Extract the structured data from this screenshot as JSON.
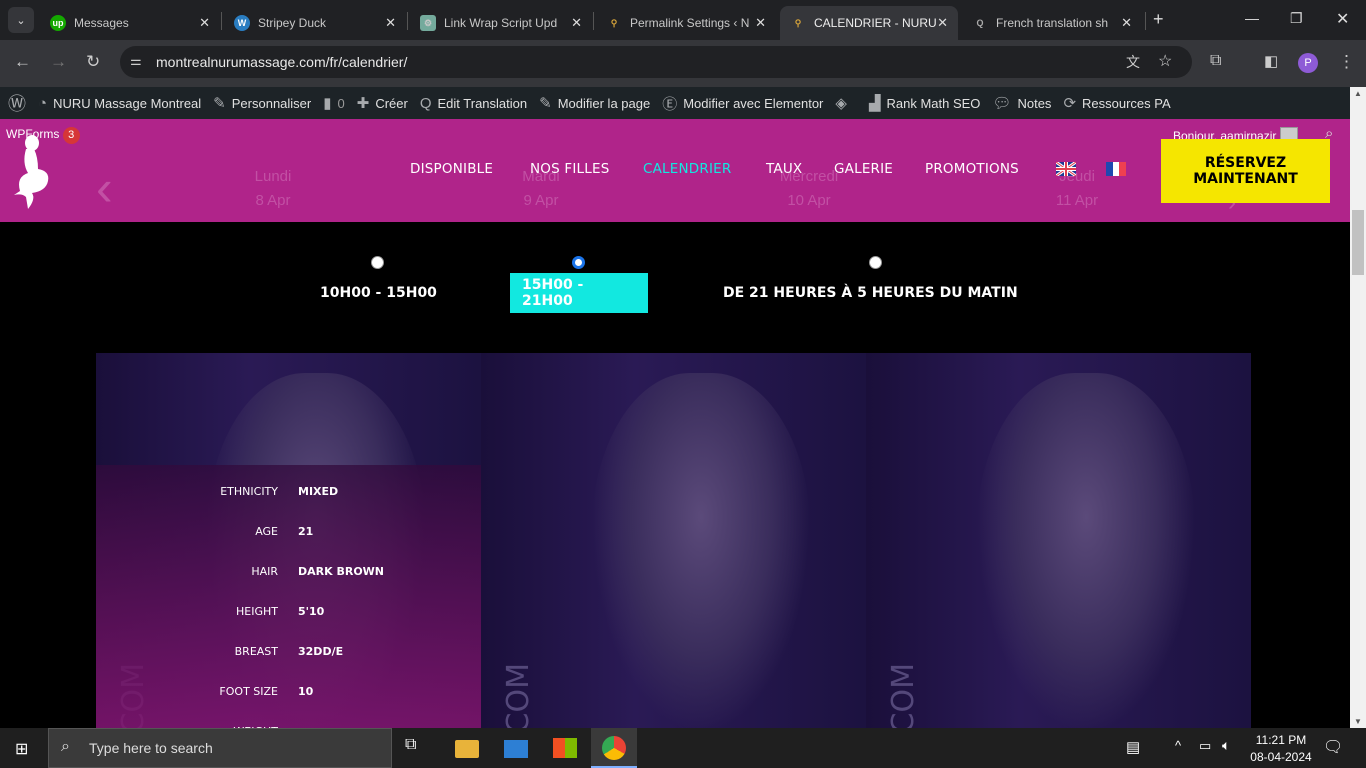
{
  "browser": {
    "tabs": [
      {
        "title": "Messages",
        "icon": "upwork-icon"
      },
      {
        "title": "Stripey Duck",
        "icon": "wordpress-icon"
      },
      {
        "title": "Link Wrap Script Upd",
        "icon": "chatgpt-icon"
      },
      {
        "title": "Permalink Settings ‹ N",
        "icon": "mermaid-icon"
      },
      {
        "title": "CALENDRIER - NURU",
        "icon": "mermaid-icon",
        "active": true
      },
      {
        "title": "French translation sh",
        "icon": "loco-icon"
      }
    ],
    "url": "montrealnurumassage.com/fr/calendrier/",
    "profile_initial": "P"
  },
  "wp_admin_bar": {
    "site": "NURU Massage Montreal",
    "customize": "Personnaliser",
    "comments": "0",
    "new": "Créer",
    "edit_translation": "Edit Translation",
    "edit_page": "Modifier la page",
    "elementor": "Modifier avec Elementor",
    "rank_math": "Rank Math SEO",
    "notes": "Notes",
    "resources": "Ressources PA",
    "wpforms": "WPForms",
    "wpforms_count": "3",
    "greeting": "Bonjour, aamirnazir"
  },
  "header": {
    "nav": [
      "DISPONIBLE",
      "NOS FILLES",
      "CALENDRIER",
      "TAUX",
      "GALERIE",
      "PROMOTIONS"
    ],
    "active_nav": "CALENDRIER",
    "reserve_line1": "RÉSERVEZ",
    "reserve_line2": "MAINTENANT",
    "days": [
      {
        "day": "Lundi",
        "date": "8 Apr"
      },
      {
        "day": "Mardi",
        "date": "9 Apr"
      },
      {
        "day": "Mercredi",
        "date": "10 Apr"
      },
      {
        "day": "Jeudi",
        "date": "11 Apr"
      }
    ]
  },
  "time_slots": [
    {
      "label": "10H00 - 15H00",
      "selected": false
    },
    {
      "label": "15H00 - 21H00",
      "selected": true
    },
    {
      "label": "DE 21 HEURES À 5 HEURES DU MATIN",
      "selected": false
    }
  ],
  "profile": {
    "vertical_text": "COM",
    "attributes": [
      {
        "label": "ETHNICITY",
        "value": "MIXED"
      },
      {
        "label": "AGE",
        "value": "21"
      },
      {
        "label": "HAIR",
        "value": "DARK BROWN"
      },
      {
        "label": "HEIGHT",
        "value": "5'10"
      },
      {
        "label": "BREAST",
        "value": "32DD/E"
      },
      {
        "label": "FOOT SIZE",
        "value": "10"
      },
      {
        "label": "WEIGHT",
        "value": ""
      }
    ]
  },
  "taskbar": {
    "search_placeholder": "Type here to search",
    "time": "11:21 PM",
    "date": "08-04-2024"
  },
  "colors": {
    "header": "#b0248a",
    "accent": "#12e8e0",
    "cta": "#f5e600"
  }
}
